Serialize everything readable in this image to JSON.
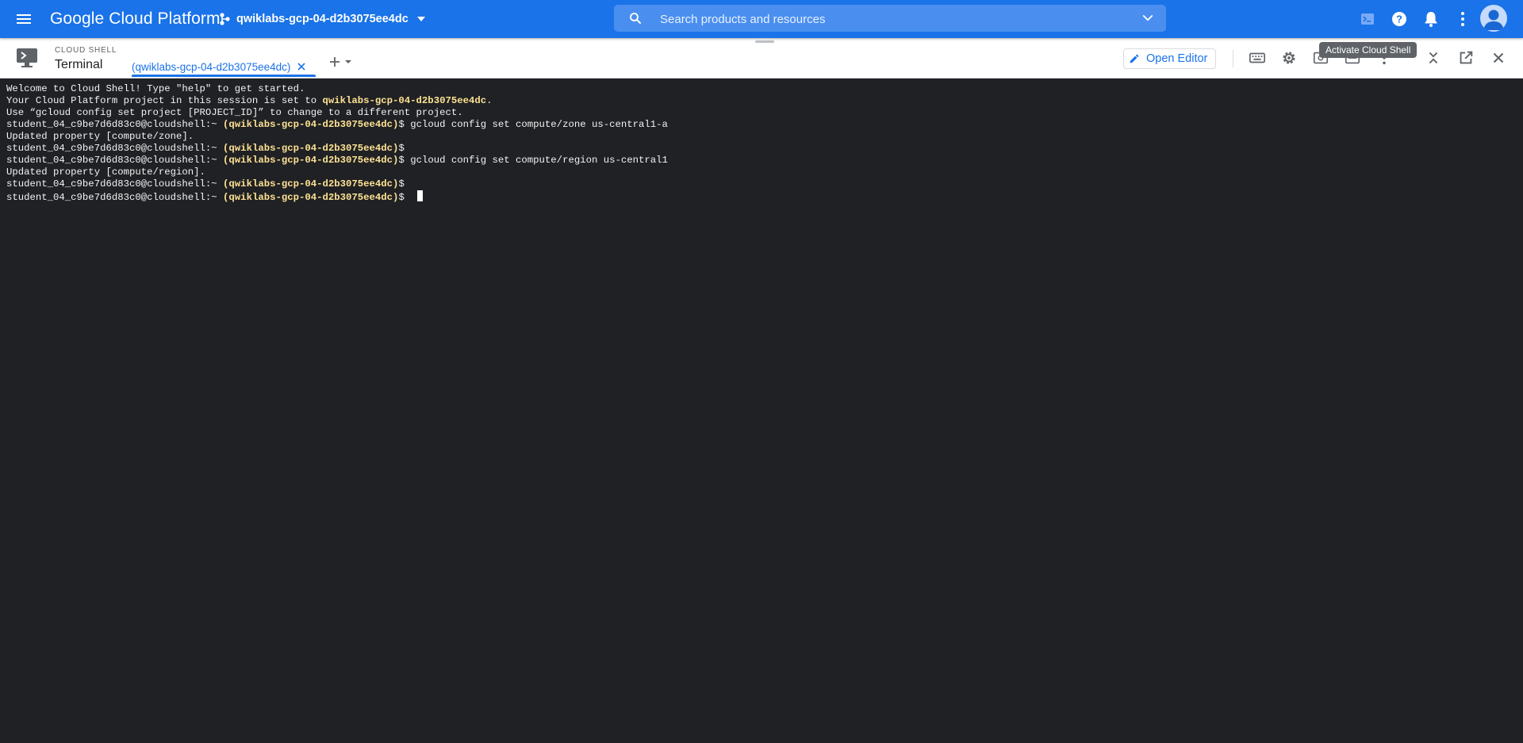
{
  "topbar": {
    "brand": "Google Cloud Platform",
    "project": "qwiklabs-gcp-04-d2b3075ee4dc",
    "search_placeholder": "Search products and resources",
    "icons": [
      "menu-icon",
      "project-hierarchy-icon",
      "caret-down-icon",
      "search-icon",
      "chevron-down-icon",
      "cloud-shell-icon",
      "help-icon",
      "notifications-icon",
      "more-vert-icon",
      "account-avatar"
    ]
  },
  "shell": {
    "kicker": "CLOUD SHELL",
    "title": "Terminal",
    "tab_label": "(qwiklabs-gcp-04-d2b3075ee4dc)",
    "open_editor_label": "Open Editor",
    "tooltip": "Activate Cloud Shell",
    "icons": [
      "terminal-monitor-icon",
      "close-tab-icon",
      "add-tab-icon",
      "tab-dropdown-icon",
      "pencil-icon",
      "keyboard-icon",
      "settings-icon",
      "web-preview-icon",
      "more-vert-icon",
      "minimize-icon",
      "open-new-window-icon",
      "close-icon"
    ]
  },
  "terminal": {
    "welcome": "Welcome to Cloud Shell! Type \"help\" to get started.",
    "project_line_pre": "Your Cloud Platform project in this session is set to ",
    "project_id": "qwiklabs-gcp-04-d2b3075ee4dc",
    "project_line_post": ".",
    "hint": "Use “gcloud config set project [PROJECT_ID]” to change to a different project.",
    "prompt_user": "student_04_c9be7d6d83c0@cloudshell:~ ",
    "prompt_project": "(qwiklabs-gcp-04-d2b3075ee4dc)",
    "prompt_symbol": "$ ",
    "cmd_zone": "gcloud config set compute/zone us-central1-a",
    "out_zone": "Updated property [compute/zone].",
    "cmd_region": "gcloud config set compute/region us-central1",
    "out_region": "Updated property [compute/region]."
  },
  "colors": {
    "blue": "#1a73e8",
    "terminal_bg": "#202124",
    "terminal_text": "#f1f3f4",
    "prompt_highlight": "#fde293"
  }
}
